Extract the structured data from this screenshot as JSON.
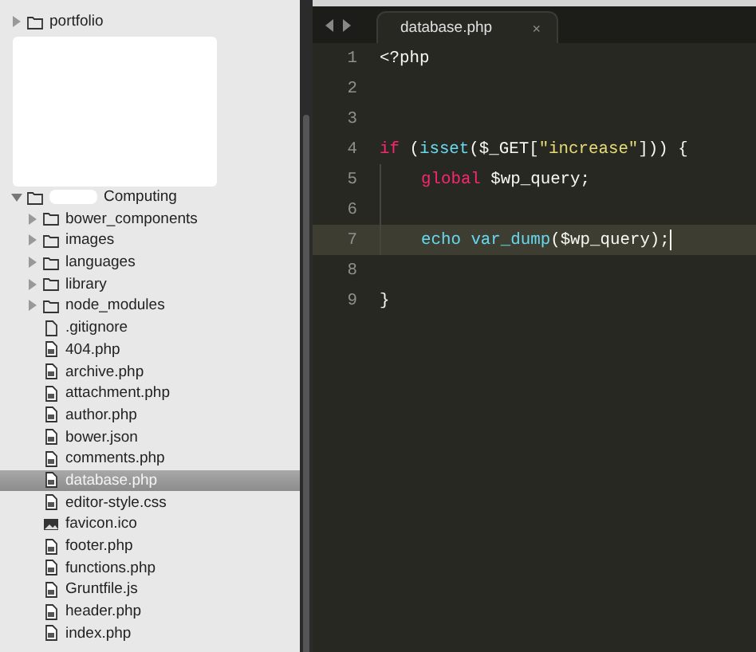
{
  "sidebar": {
    "items": [
      {
        "label": "portfolio",
        "kind": "folder",
        "expanded": false,
        "selected": false,
        "redacted_prefix": false
      },
      {
        "label": "Computing",
        "kind": "folder",
        "expanded": true,
        "selected": false,
        "redacted_prefix": true,
        "children": [
          {
            "label": "bower_components",
            "kind": "folder",
            "expanded": false,
            "selected": false,
            "redacted_prefix": false
          },
          {
            "label": "images",
            "kind": "folder",
            "expanded": false,
            "selected": false,
            "redacted_prefix": false
          },
          {
            "label": "languages",
            "kind": "folder",
            "expanded": false,
            "selected": false,
            "redacted_prefix": false
          },
          {
            "label": "library",
            "kind": "folder",
            "expanded": false,
            "selected": false,
            "redacted_prefix": false
          },
          {
            "label": "node_modules",
            "kind": "folder",
            "expanded": false,
            "selected": false,
            "redacted_prefix": false
          },
          {
            "label": ".gitignore",
            "kind": "file",
            "selected": false,
            "redacted_prefix": false
          },
          {
            "label": "404.php",
            "kind": "code",
            "selected": false,
            "redacted_prefix": false
          },
          {
            "label": "archive.php",
            "kind": "code",
            "selected": false,
            "redacted_prefix": false
          },
          {
            "label": "attachment.php",
            "kind": "code",
            "selected": false,
            "redacted_prefix": false
          },
          {
            "label": "author.php",
            "kind": "code",
            "selected": false,
            "redacted_prefix": false
          },
          {
            "label": "bower.json",
            "kind": "code",
            "selected": false,
            "redacted_prefix": false
          },
          {
            "label": "comments.php",
            "kind": "code",
            "selected": false,
            "redacted_prefix": false
          },
          {
            "label": "database.php",
            "kind": "code",
            "selected": true,
            "redacted_prefix": false
          },
          {
            "label": "editor-style.css",
            "kind": "code",
            "selected": false,
            "redacted_prefix": false
          },
          {
            "label": "favicon.ico",
            "kind": "image",
            "selected": false,
            "redacted_prefix": false
          },
          {
            "label": "footer.php",
            "kind": "code",
            "selected": false,
            "redacted_prefix": false
          },
          {
            "label": "functions.php",
            "kind": "code",
            "selected": false,
            "redacted_prefix": false
          },
          {
            "label": "Gruntfile.js",
            "kind": "code",
            "selected": false,
            "redacted_prefix": false
          },
          {
            "label": "header.php",
            "kind": "code",
            "selected": false,
            "redacted_prefix": false
          },
          {
            "label": "index.php",
            "kind": "code",
            "selected": false,
            "redacted_prefix": false
          }
        ]
      }
    ]
  },
  "tabs": [
    {
      "label": "database.php",
      "selected": true,
      "close": "×"
    }
  ],
  "editor": {
    "lines": [
      {
        "number": "1",
        "current": false,
        "indented": false,
        "tokens": [
          {
            "text": "<?php",
            "kind": "plain"
          }
        ]
      },
      {
        "number": "2",
        "current": false,
        "indented": false
      },
      {
        "number": "3",
        "current": false,
        "indented": false
      },
      {
        "number": "4",
        "current": false,
        "indented": false,
        "tokens": [
          {
            "text": "if",
            "kind": "keyword"
          },
          {
            "text": " (",
            "kind": "plain"
          },
          {
            "text": "isset",
            "kind": "function"
          },
          {
            "text": "($_GET[",
            "kind": "plain"
          },
          {
            "text": "\"increase\"",
            "kind": "string"
          },
          {
            "text": "])) {",
            "kind": "plain"
          }
        ]
      },
      {
        "number": "5",
        "current": false,
        "indented": true,
        "tokens": [
          {
            "text": "global",
            "kind": "keyword"
          },
          {
            "text": " $wp_query;",
            "kind": "plain"
          }
        ]
      },
      {
        "number": "6",
        "current": false,
        "indented": true
      },
      {
        "number": "7",
        "current": true,
        "indented": true,
        "tokens": [
          {
            "text": "echo",
            "kind": "function"
          },
          {
            "text": " var_dump",
            "kind": "function"
          },
          {
            "text": "($wp_query);",
            "kind": "plain"
          }
        ]
      },
      {
        "number": "8",
        "current": false,
        "indented": false
      },
      {
        "number": "9",
        "current": false,
        "indented": false,
        "tokens": [
          {
            "text": "}",
            "kind": "plain"
          }
        ]
      }
    ]
  }
}
